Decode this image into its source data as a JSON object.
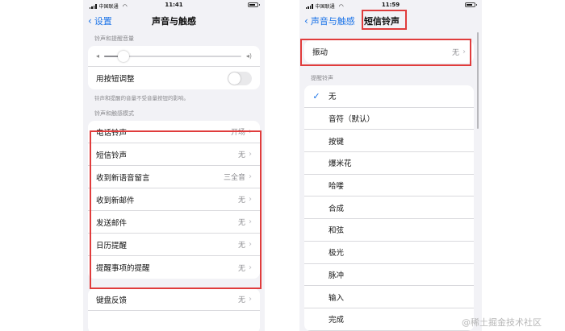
{
  "left": {
    "status": {
      "carrier": "中国联通",
      "time": "11:41"
    },
    "nav": {
      "back_label": "设置",
      "title": "声音与触感"
    },
    "volume_section_label": "铃声和提醒音量",
    "volume_level": 0.14,
    "button_adjust_label": "用按钮调整",
    "button_adjust_on": false,
    "volume_note": "铃声和提醒的音量不受音量按钮的影响。",
    "pattern_section_label": "铃声和触感模式",
    "patterns": [
      {
        "label": "电话铃声",
        "value": "开场"
      },
      {
        "label": "短信铃声",
        "value": "无"
      },
      {
        "label": "收到新语音留言",
        "value": "三全音"
      },
      {
        "label": "收到新邮件",
        "value": "无"
      },
      {
        "label": "发送邮件",
        "value": "无"
      },
      {
        "label": "日历提醒",
        "value": "无"
      },
      {
        "label": "提醒事项的提醒",
        "value": "无"
      }
    ],
    "keyboard_feedback": {
      "label": "键盘反馈",
      "value": "无"
    }
  },
  "right": {
    "status": {
      "carrier": "中国联通",
      "time": "11:59"
    },
    "nav": {
      "back_label": "声音与触感",
      "title": "短信铃声"
    },
    "vibration": {
      "label": "振动",
      "value": "无"
    },
    "tones_section_label": "提醒铃声",
    "tones": [
      "无",
      "音符（默认）",
      "按键",
      "爆米花",
      "哈喽",
      "合成",
      "和弦",
      "极光",
      "脉冲",
      "输入",
      "完成"
    ],
    "selected_tone": "无"
  },
  "watermark": "@稀土掘金技术社区",
  "colors": {
    "accent": "#1a73e8",
    "highlight_border": "#e03c3c",
    "background": "#f2f2f6"
  }
}
